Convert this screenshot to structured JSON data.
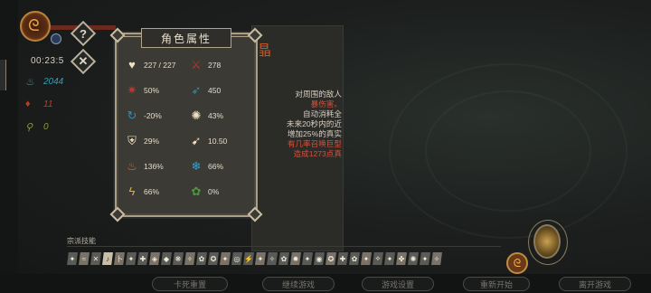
{
  "hud": {
    "timer": "00:23:5",
    "resources": [
      {
        "icon": "soul-flame-icon",
        "value": "2044",
        "color": "#3a9ab0"
      },
      {
        "icon": "blood-drop-icon",
        "value": "11",
        "color": "#c03a2a"
      },
      {
        "icon": "key-icon",
        "value": "0",
        "color": "#8a9a3a"
      }
    ],
    "help_label": "?",
    "close_label": "✕"
  },
  "panel": {
    "title": "角色属性",
    "stats": [
      {
        "icon": "health-heart-icon",
        "value": "227 / 227",
        "color": "#f0e0c0"
      },
      {
        "icon": "attack-claw-icon",
        "value": "278",
        "color": "#c0352a"
      },
      {
        "icon": "crit-rate-icon",
        "value": "50%",
        "color": "#c0352a"
      },
      {
        "icon": "crit-damage-icon",
        "value": "450",
        "color": "#2f8fb0"
      },
      {
        "icon": "damage-reduction-icon",
        "value": "-20%",
        "color": "#2f8fb0"
      },
      {
        "icon": "dodge-wing-icon",
        "value": "43%",
        "color": "#f0e0c0"
      },
      {
        "icon": "shield-icon",
        "value": "29%",
        "color": "#f0e0c0"
      },
      {
        "icon": "speed-boot-icon",
        "value": "10.50",
        "color": "#f0e0c0"
      },
      {
        "icon": "fire-icon",
        "value": "136%",
        "color": "#e06a20"
      },
      {
        "icon": "snowflake-icon",
        "value": "66%",
        "color": "#3aa0d0"
      },
      {
        "icon": "lightning-icon",
        "value": "66%",
        "color": "#e0b030"
      },
      {
        "icon": "poison-swirl-icon",
        "value": "0%",
        "color": "#4a9a3a"
      }
    ]
  },
  "scroll": {
    "title_fragment": "晶",
    "description_lines": [
      {
        "text": "对周围的敌人",
        "color": "#d8cfc0"
      },
      {
        "text": "暴伤害。",
        "color": "#d8503a"
      },
      {
        "text": "自动消耗全",
        "color": "#d8cfc0"
      },
      {
        "text": "未来20秒内的近",
        "color": "#d8cfc0"
      },
      {
        "text": "增加25%的真实",
        "color": "#d8cfc0"
      },
      {
        "text": "有几率召唤巨型",
        "color": "#d8503a"
      },
      {
        "text": "造成1273点真",
        "color": "#d8503a"
      }
    ]
  },
  "skills": {
    "label": "宗派技能",
    "icons": [
      "✦",
      "≈",
      "✕",
      "♪",
      "卜",
      "✦",
      "✚",
      "◈",
      "◆",
      "❋",
      "✧",
      "✿",
      "✪",
      "✦",
      "◎",
      "⚡",
      "✦",
      "✧",
      "✿",
      "✹",
      "✦",
      "◉",
      "✪",
      "✚",
      "✿",
      "✦",
      "⟡",
      "✦",
      "✤",
      "✺",
      "✦",
      "✧"
    ]
  },
  "bottom_buttons": [
    "卡死重置",
    "继续游戏",
    "游戏设置",
    "重新开始",
    "离开游戏"
  ]
}
